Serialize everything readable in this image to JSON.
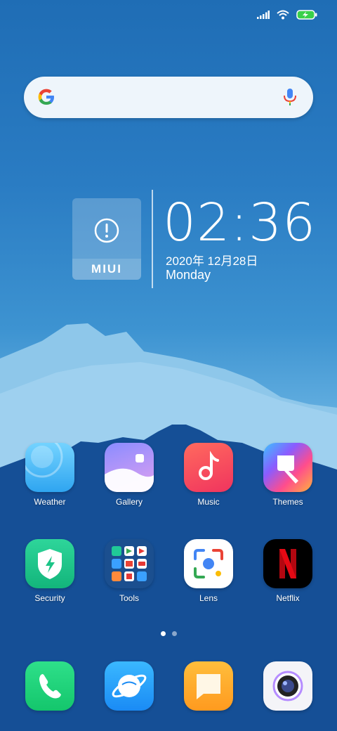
{
  "status_bar": {
    "signal_icon": "signal-icon",
    "wifi_icon": "wifi-icon",
    "battery_icon": "battery-charging-icon"
  },
  "search": {
    "logo_icon": "google-g-icon",
    "mic_icon": "microphone-icon"
  },
  "clock_widget": {
    "brand": "MIUI",
    "time": "02:36",
    "date": "2020年 12月28日",
    "weekday": "Monday"
  },
  "apps": {
    "row1": [
      {
        "label": "Weather",
        "icon": "weather-icon"
      },
      {
        "label": "Gallery",
        "icon": "gallery-icon"
      },
      {
        "label": "Music",
        "icon": "music-icon"
      },
      {
        "label": "Themes",
        "icon": "themes-icon"
      }
    ],
    "row2": [
      {
        "label": "Security",
        "icon": "security-icon"
      },
      {
        "label": "Tools",
        "icon": "tools-folder-icon"
      },
      {
        "label": "Lens",
        "icon": "lens-icon"
      },
      {
        "label": "Netflix",
        "icon": "netflix-icon"
      }
    ]
  },
  "dock": [
    {
      "icon": "phone-icon"
    },
    {
      "icon": "browser-icon"
    },
    {
      "icon": "messages-icon"
    },
    {
      "icon": "camera-icon"
    }
  ],
  "page_indicator": {
    "current": 1,
    "total": 2
  },
  "colors": {
    "accent": "#1f6db5",
    "netflix_red": "#e50914",
    "music_red": "#f2495a"
  }
}
